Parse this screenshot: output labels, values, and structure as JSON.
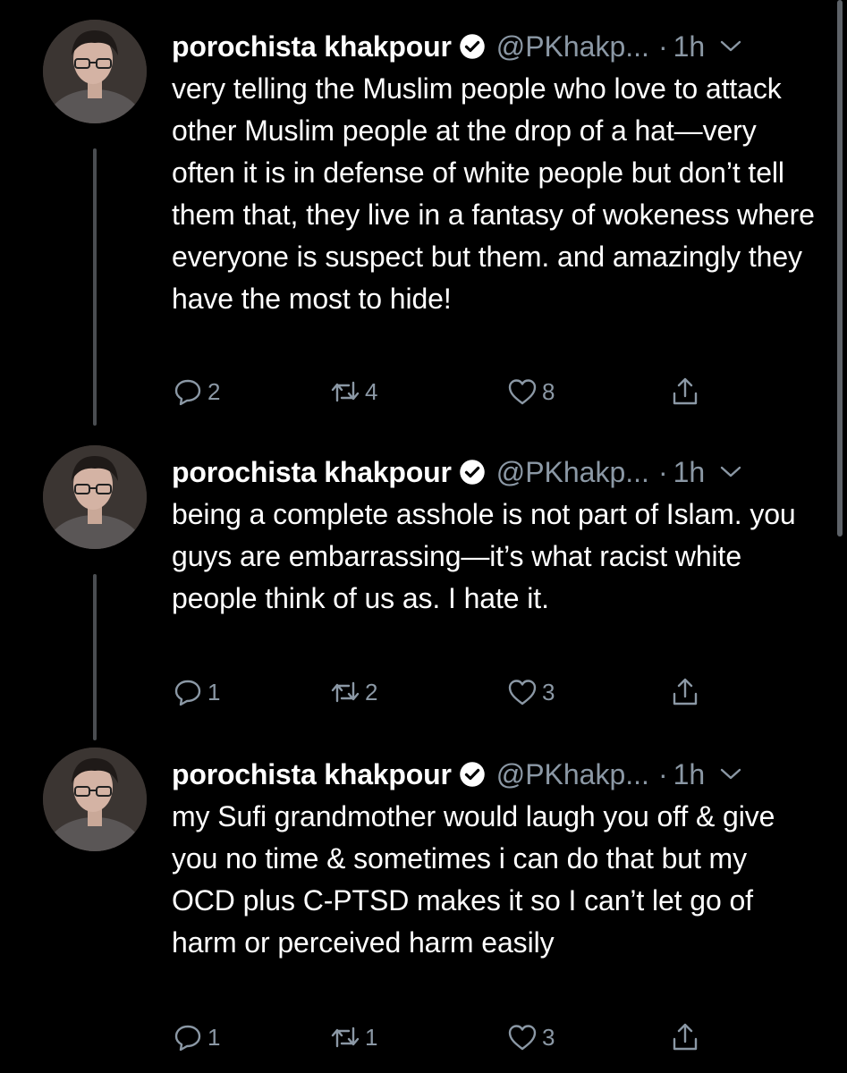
{
  "tweets": [
    {
      "display_name": "porochista khakpour",
      "handle": "@PKhakp...",
      "dot": "·",
      "time": "1h",
      "icons": {
        "verified": "verified-badge-icon",
        "more": "chevron-down-icon"
      },
      "text": "very telling the Muslim people who love to attack other Muslim people at the drop of a hat—very often it is in defense of white people but don’t tell them that, they live in a fantasy of wokeness where everyone is suspect but them. and amazingly they have the most to hide!",
      "replies": "2",
      "retweets": "4",
      "likes": "8"
    },
    {
      "display_name": "porochista khakpour",
      "handle": "@PKhakp...",
      "dot": "·",
      "time": "1h",
      "icons": {
        "verified": "verified-badge-icon",
        "more": "chevron-down-icon"
      },
      "text": "being a complete asshole is not part of Islam. you guys are embarrassing—it’s what racist white people think of us as. I hate it.",
      "replies": "1",
      "retweets": "2",
      "likes": "3"
    },
    {
      "display_name": "porochista khakpour",
      "handle": "@PKhakp...",
      "dot": "·",
      "time": "1h",
      "icons": {
        "verified": "verified-badge-icon",
        "more": "chevron-down-icon"
      },
      "text": "my Sufi grandmother would laugh you off & give you no time & sometimes i can do that but my OCD plus C-PTSD makes it so I can’t let go of harm or perceived harm easily",
      "replies": "1",
      "retweets": "1",
      "likes": "3"
    }
  ],
  "colors": {
    "background": "#000000",
    "text": "#ffffff",
    "secondary": "#8b98a5",
    "thread_line": "#4a4d51"
  }
}
